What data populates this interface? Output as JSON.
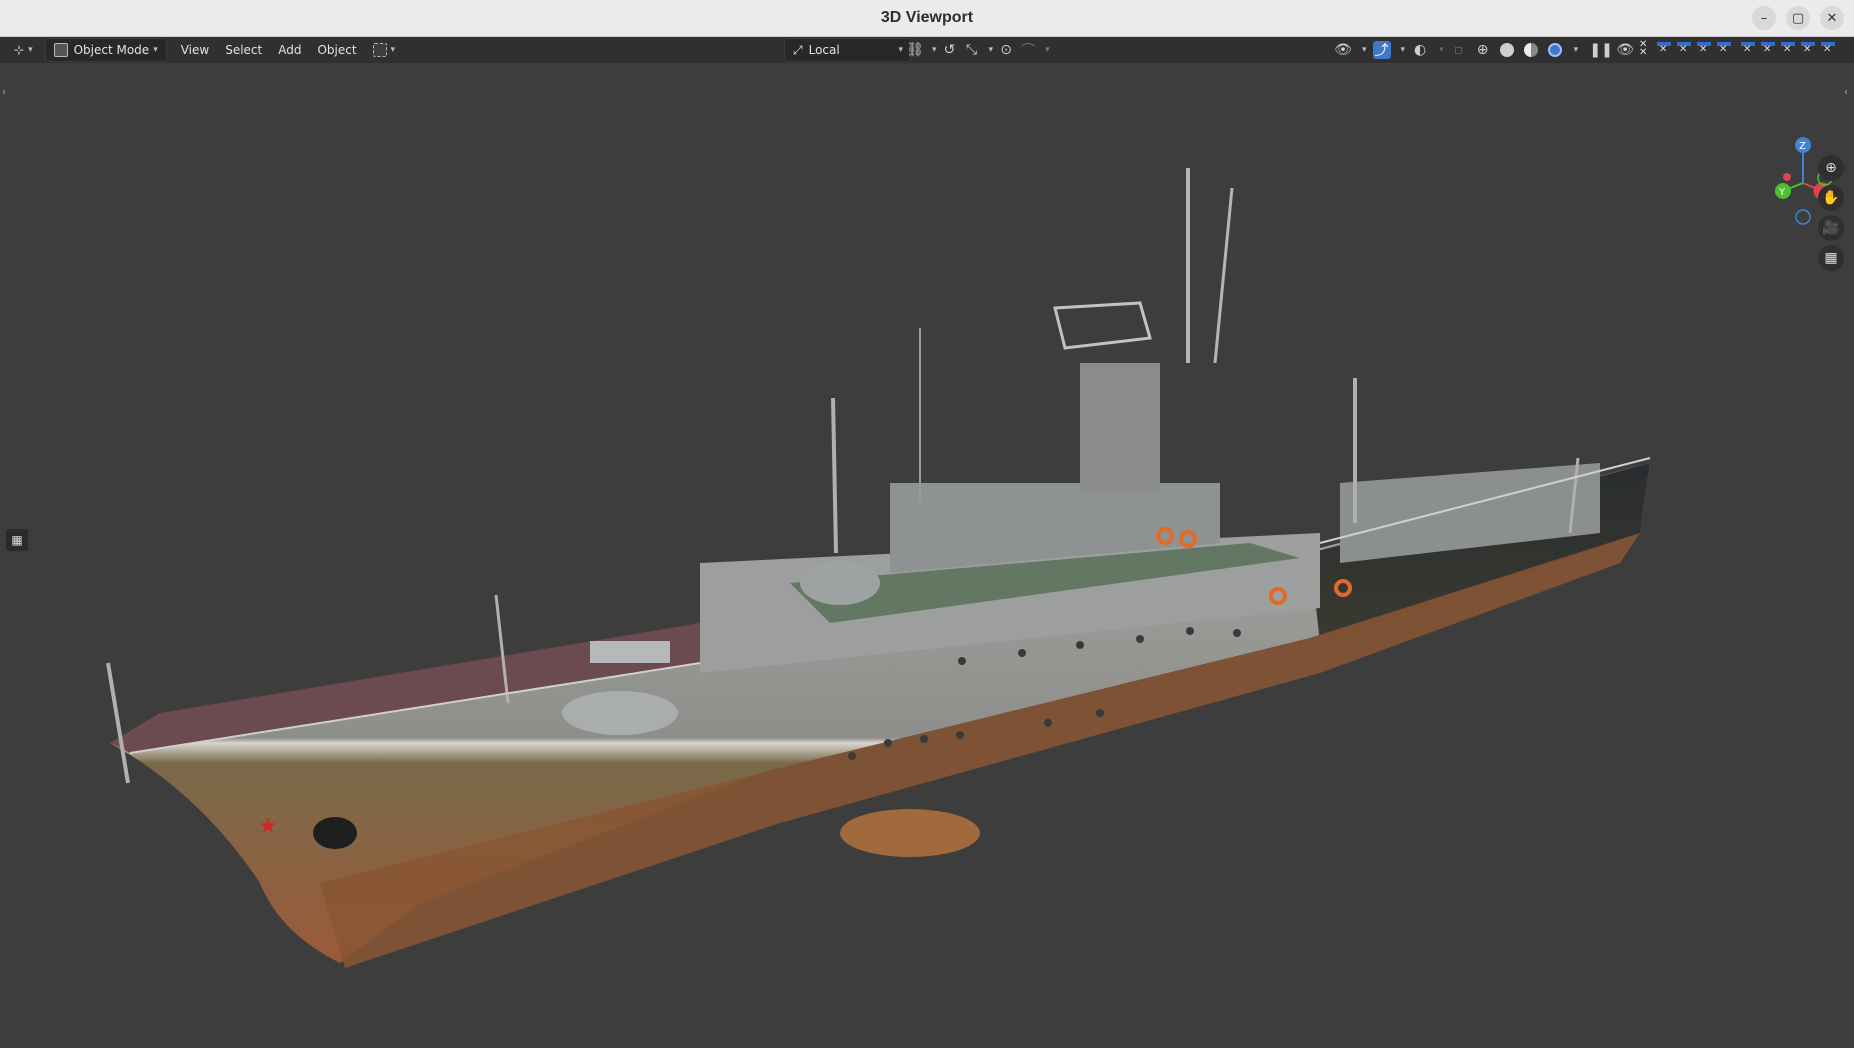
{
  "window": {
    "title": "3D Viewport",
    "controls": [
      "–",
      "▢",
      "✕"
    ]
  },
  "header": {
    "editor_type_icon": "view3d-icon",
    "mode_label": "Object Mode",
    "menus": [
      "View",
      "Select",
      "Add",
      "Object"
    ],
    "transform_orientation": "Local",
    "icons": [
      "pivot-icon",
      "snap-icon",
      "proportional-edit-icon",
      "visibility-icon",
      "gizmo-icon",
      "overlay-icon",
      "xray-icon",
      "shading-wireframe-icon",
      "shading-solid-icon",
      "shading-material-icon",
      "shading-rendered-icon"
    ],
    "pause_glyph": "❚❚"
  },
  "viewport": {
    "gizmo_axes": [
      "Z",
      "Y"
    ],
    "nav_tools": [
      "zoom-icon",
      "hand-pan-icon",
      "camera-icon",
      "grid-ortho-icon"
    ]
  },
  "colors": {
    "viewport_bg": "#3d3d3d",
    "header_bg": "#303030",
    "accent_blue": "#3f78c7",
    "axis_x": "#e04646",
    "axis_y": "#4cc02e",
    "axis_z": "#3f82d8"
  }
}
